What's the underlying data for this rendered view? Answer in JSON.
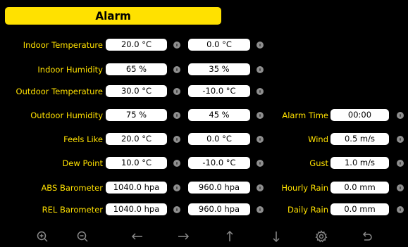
{
  "title": "Alarm",
  "rows": [
    {
      "label": "Indoor Temperature",
      "high": "20.0 °C",
      "low": "0.0 °C"
    },
    {
      "label": "Indoor Humidity",
      "high": "65 %",
      "low": "35 %"
    },
    {
      "label": "Outdoor Temperature",
      "high": "30.0 °C",
      "low": "-10.0 °C"
    },
    {
      "label": "Outdoor Humidity",
      "high": "75 %",
      "low": "45 %"
    },
    {
      "label": "Feels Like",
      "high": "20.0 °C",
      "low": "0.0 °C"
    },
    {
      "label": "Dew Point",
      "high": "10.0 °C",
      "low": "-10.0 °C"
    },
    {
      "label": "ABS Barometer",
      "high": "1040.0 hpa",
      "low": "960.0 hpa"
    },
    {
      "label": "REL Barometer",
      "high": "1040.0 hpa",
      "low": "960.0 hpa"
    }
  ],
  "right": [
    {
      "label": "Alarm Time",
      "value": "00:00"
    },
    {
      "label": "Wind",
      "value": "0.5 m/s"
    },
    {
      "label": "Gust",
      "value": "1.0 m/s"
    },
    {
      "label": "Hourly Rain",
      "value": "0.0 mm"
    },
    {
      "label": "Daily Rain",
      "value": "0.0 mm"
    }
  ],
  "toolbar": [
    "zoom-in-icon",
    "zoom-out-icon",
    "arrow-left-icon",
    "arrow-right-icon",
    "arrow-up-icon",
    "arrow-down-icon",
    "gear-icon",
    "back-icon"
  ],
  "colors": {
    "accent": "#ffe100",
    "background": "#000000"
  }
}
